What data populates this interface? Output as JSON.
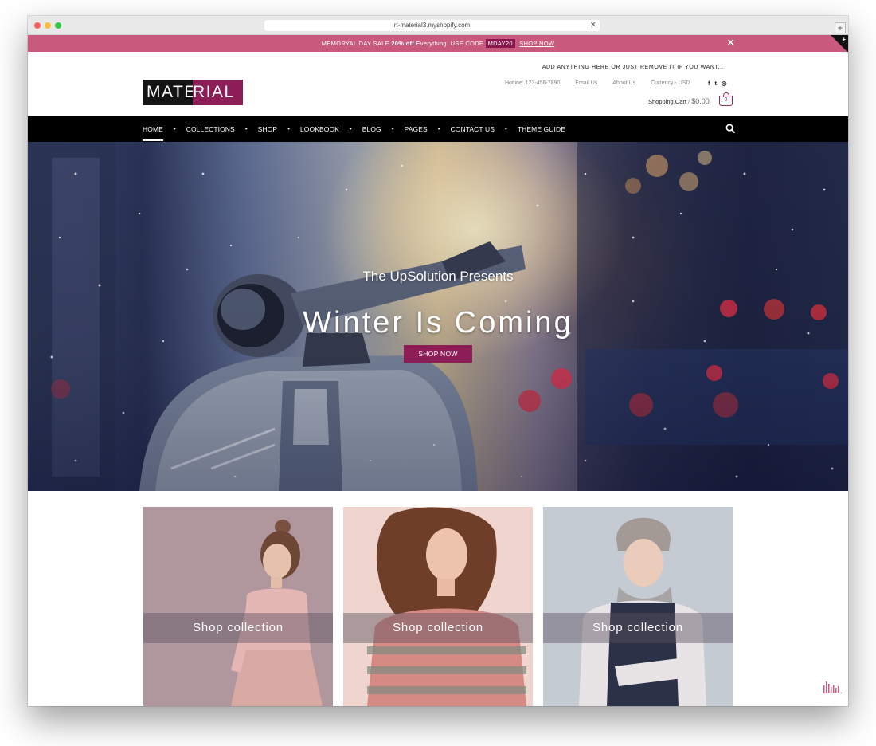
{
  "browser": {
    "url": "rt-material3.myshopify.com",
    "url_close_glyph": "✕",
    "newtab_glyph": "+"
  },
  "promo": {
    "text_before": "MEMORYAL DAY SALE ",
    "highlight": "20% off",
    "text_middle": " Everything. USE CODE ",
    "code": "MDAY20",
    "link": "SHOP NOW",
    "close_glyph": "✕",
    "corner_glyph": "+",
    "bg_color": "#c85a7e"
  },
  "header": {
    "logo_left": "MATE",
    "logo_right": "RIAL",
    "tagline": "ADD ANYTHING HERE OR JUST REMOVE IT IF YOU WANT...",
    "links": [
      "Hotline: 123-456-7890",
      "Email Us",
      "About Us",
      "Currency - USD"
    ],
    "socials": [
      "f",
      "t",
      "◎"
    ],
    "cart_label": "Shopping Cart",
    "cart_sep": " / ",
    "cart_amount": "$0.00",
    "cart_count": "0"
  },
  "nav": {
    "items": [
      "HOME",
      "COLLECTIONS",
      "SHOP",
      "LOOKBOOK",
      "BLOG",
      "PAGES",
      "CONTACT US",
      "THEME GUIDE"
    ],
    "separator": "•",
    "active_index": 0
  },
  "hero": {
    "subtitle": "The UpSolution Presents",
    "title": "Winter Is Coming",
    "button": "SHOP NOW"
  },
  "collections": [
    {
      "label": "Shop collection"
    },
    {
      "label": "Shop collection"
    },
    {
      "label": "Shop collection"
    }
  ],
  "colors": {
    "accent": "#8c1d56",
    "nav_bg": "#000000",
    "promo": "#c85a7e"
  }
}
